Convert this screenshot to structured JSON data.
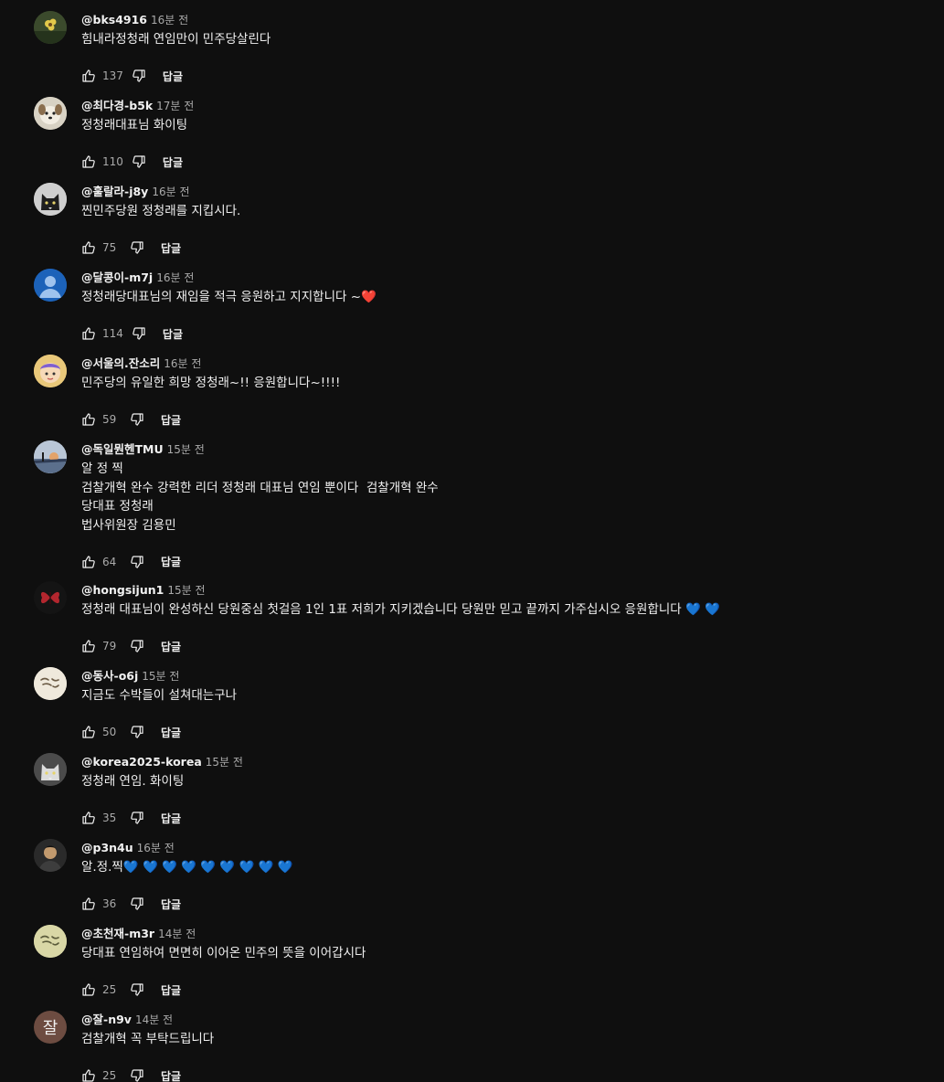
{
  "comments": [
    {
      "author": "@bks4916",
      "time": "16분 전",
      "lines": [
        "힘내라정청래 연임만이 민주당살린다"
      ],
      "likes": "137",
      "reply": "답글",
      "avatar": {
        "kind": "image",
        "icon": "flower-avatar-icon",
        "bg": "#3b4a2c",
        "fg": "#e3c84a"
      }
    },
    {
      "author": "@최다경-b5k",
      "time": "17분 전",
      "lines": [
        "정청래대표님 화이팅"
      ],
      "likes": "110",
      "reply": "답글",
      "avatar": {
        "kind": "image",
        "icon": "dog-avatar-icon",
        "bg": "#d8d2c4",
        "fg": "#8a6e4e"
      }
    },
    {
      "author": "@훌랄라-j8y",
      "time": "16분 전",
      "lines": [
        "찐민주당원 정청래를 지킵시다."
      ],
      "likes": "75",
      "reply": "답글",
      "avatar": {
        "kind": "image",
        "icon": "cat-avatar-icon",
        "bg": "#cfcfcf",
        "fg": "#1e1e1e"
      }
    },
    {
      "author": "@달콩이-m7j",
      "time": "16분 전",
      "lines": [
        "정청래당대표님의 재임을 적극 응원하고 지지합니다 ~❤️"
      ],
      "likes": "114",
      "reply": "답글",
      "avatar": {
        "kind": "default",
        "icon": "default-user-avatar-icon",
        "bg": "#1c62b9",
        "fg": "#9fc3ee"
      }
    },
    {
      "author": "@서울의.잔소리",
      "time": "16분 전",
      "lines": [
        "민주당의 유일한 희망 정청래~!! 응원합니다~!!!!"
      ],
      "likes": "59",
      "reply": "답글",
      "avatar": {
        "kind": "image",
        "icon": "cartoon-avatar-icon",
        "bg": "#e9c87a",
        "fg": "#7f5fd0"
      }
    },
    {
      "author": "@독일뭔헨TMU",
      "time": "15분 전",
      "lines": [
        "알 정 찍",
        "검찰개혁 완수 강력한 리더 정청래 대표님 연임 뿐이다  검찰개혁 완수",
        "당대표 정청래",
        "법사위원장 김용민"
      ],
      "likes": "64",
      "reply": "답글",
      "avatar": {
        "kind": "image",
        "icon": "sunset-avatar-icon",
        "bg": "#b9c6d6",
        "fg": "#e3a36a"
      }
    },
    {
      "author": "@hongsijun1",
      "time": "15분 전",
      "lines": [
        "정청래 대표님이 완성하신 당원중심 첫걸음 1인 1표 저희가 지키겠습니다 당원만 믿고 끝까지 가주십시오 응원합니다 💙 💙"
      ],
      "likes": "79",
      "reply": "답글",
      "avatar": {
        "kind": "image",
        "icon": "butterfly-avatar-icon",
        "bg": "#141414",
        "fg": "#b3262e"
      }
    },
    {
      "author": "@동사-o6j",
      "time": "15분 전",
      "lines": [
        "지금도 수박들이 설쳐대는구나"
      ],
      "likes": "50",
      "reply": "답글",
      "avatar": {
        "kind": "image",
        "icon": "calligraphy-avatar-icon",
        "bg": "#efe9dc",
        "fg": "#6b5b45"
      }
    },
    {
      "author": "@korea2025-korea",
      "time": "15분 전",
      "lines": [
        "정청래 연임. 화이팅"
      ],
      "likes": "35",
      "reply": "답글",
      "avatar": {
        "kind": "image",
        "icon": "cat-avatar-icon",
        "bg": "#4b4b4b",
        "fg": "#dcdcdc"
      }
    },
    {
      "author": "@p3n4u",
      "time": "16분 전",
      "lines": [
        "알.정.찍💙 💙 💙 💙 💙 💙 💙 💙 💙"
      ],
      "likes": "36",
      "reply": "답글",
      "avatar": {
        "kind": "image",
        "icon": "portrait-avatar-icon",
        "bg": "#2a2a2a",
        "fg": "#c29a6e"
      }
    },
    {
      "author": "@초천재-m3r",
      "time": "14분 전",
      "lines": [
        "당대표 연임하여 면면히 이어온 민주의 뜻을 이어갑시다"
      ],
      "likes": "25",
      "reply": "답글",
      "avatar": {
        "kind": "image",
        "icon": "calligraphy-avatar-icon",
        "bg": "#d9d7a6",
        "fg": "#5a5a3a"
      }
    },
    {
      "author": "@잘-n9v",
      "time": "14분 전",
      "lines": [
        "검찰개혁 꼭 부탁드립니다"
      ],
      "likes": "25",
      "reply": "답글",
      "avatar": {
        "kind": "letter",
        "letter": "잘",
        "icon": "letter-avatar-icon",
        "bg": "#6d4c41",
        "fg": "#f1f1f1"
      }
    }
  ],
  "icons": {
    "like": "thumbs-up-icon",
    "dislike": "thumbs-down-icon"
  }
}
